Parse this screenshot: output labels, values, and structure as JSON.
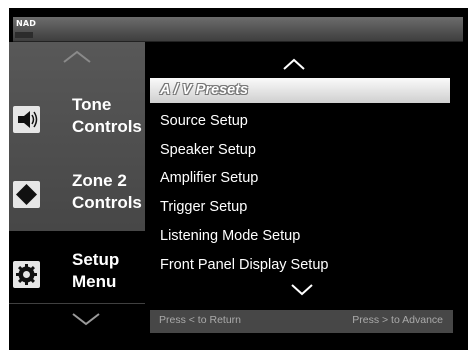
{
  "header": {
    "brand": "NAD"
  },
  "sidebar": {
    "items": [
      {
        "lines": [
          "Tone",
          "Controls"
        ],
        "icon": "speaker-icon"
      },
      {
        "lines": [
          "Zone 2",
          "Controls"
        ],
        "icon": "diamond-icon"
      },
      {
        "lines": [
          "Setup",
          "Menu"
        ],
        "icon": "gear-icon"
      }
    ]
  },
  "menu": {
    "items": [
      {
        "label": "A / V  Presets"
      },
      {
        "label": "Source Setup"
      },
      {
        "label": "Speaker Setup"
      },
      {
        "label": "Amplifier Setup"
      },
      {
        "label": "Trigger Setup"
      },
      {
        "label": "Listening Mode Setup"
      },
      {
        "label": "Front Panel Display Setup"
      }
    ],
    "selected_index": 0
  },
  "footer": {
    "left": "Press < to Return",
    "right": "Press > to Advance"
  }
}
